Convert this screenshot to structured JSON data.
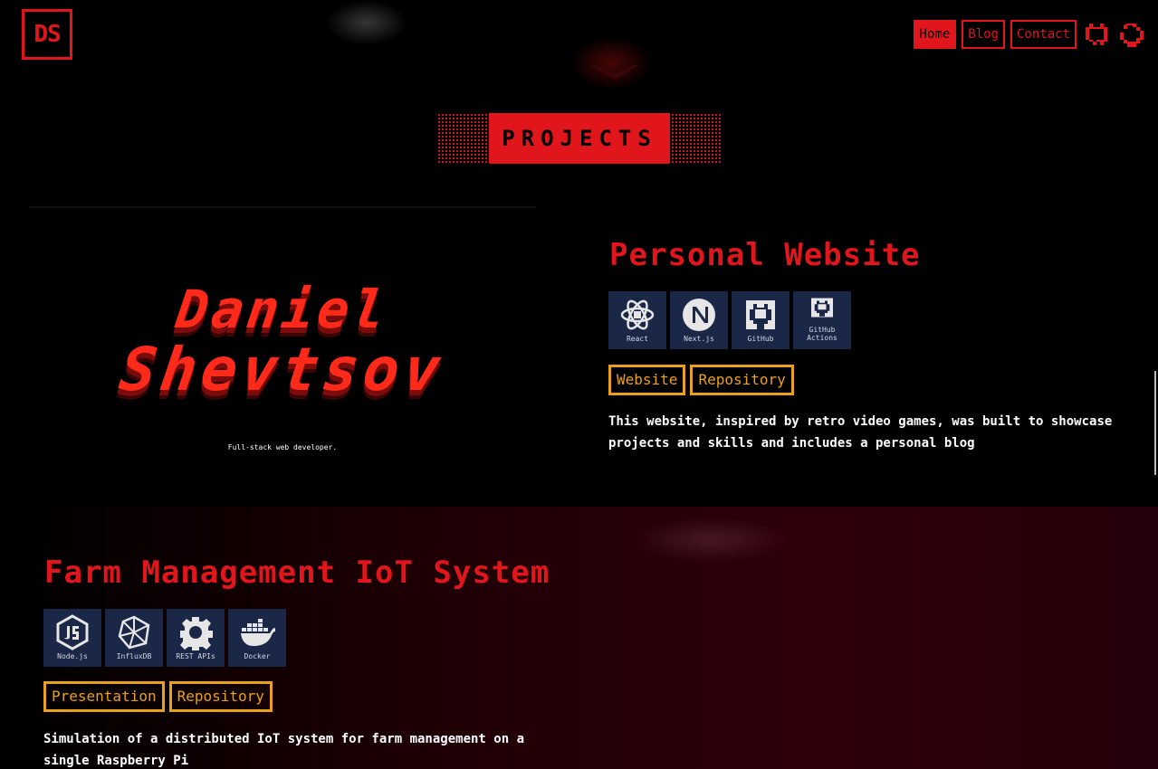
{
  "header": {
    "logo_text": "DS",
    "nav": [
      {
        "label": "Home",
        "active": true
      },
      {
        "label": "Blog",
        "active": false
      },
      {
        "label": "Contact",
        "active": false
      }
    ],
    "icons": [
      "github-icon",
      "theme-toggle-icon"
    ]
  },
  "banner": {
    "label": "PROJECTS"
  },
  "projects": [
    {
      "title": "Personal Website",
      "preview": {
        "first_name": "Daniel",
        "last_name": "Shevtsov",
        "tagline": "Full-stack web developer."
      },
      "tech": [
        {
          "label": "React",
          "icon": "react-icon"
        },
        {
          "label": "Next.js",
          "icon": "nextjs-icon"
        },
        {
          "label": "GitHub",
          "icon": "github-icon"
        },
        {
          "label": "GitHub Actions",
          "icon": "github-actions-icon"
        }
      ],
      "links": [
        "Website",
        "Repository"
      ],
      "description": "This website, inspired by retro video games, was built to showcase projects and skills and includes a personal blog"
    },
    {
      "title": "Farm Management IoT System",
      "tech": [
        {
          "label": "Node.js",
          "icon": "nodejs-icon"
        },
        {
          "label": "InfluxDB",
          "icon": "influxdb-icon"
        },
        {
          "label": "REST APIs",
          "icon": "gear-icon"
        },
        {
          "label": "Docker",
          "icon": "docker-icon"
        }
      ],
      "links": [
        "Presentation",
        "Repository"
      ],
      "description": "Simulation of a distributed IoT system for farm management on a single Raspberry Pi"
    }
  ],
  "colors": {
    "accent": "#e0161c",
    "link": "#e9a11a",
    "badge_bg": "#1a2747",
    "background": "#000000"
  }
}
